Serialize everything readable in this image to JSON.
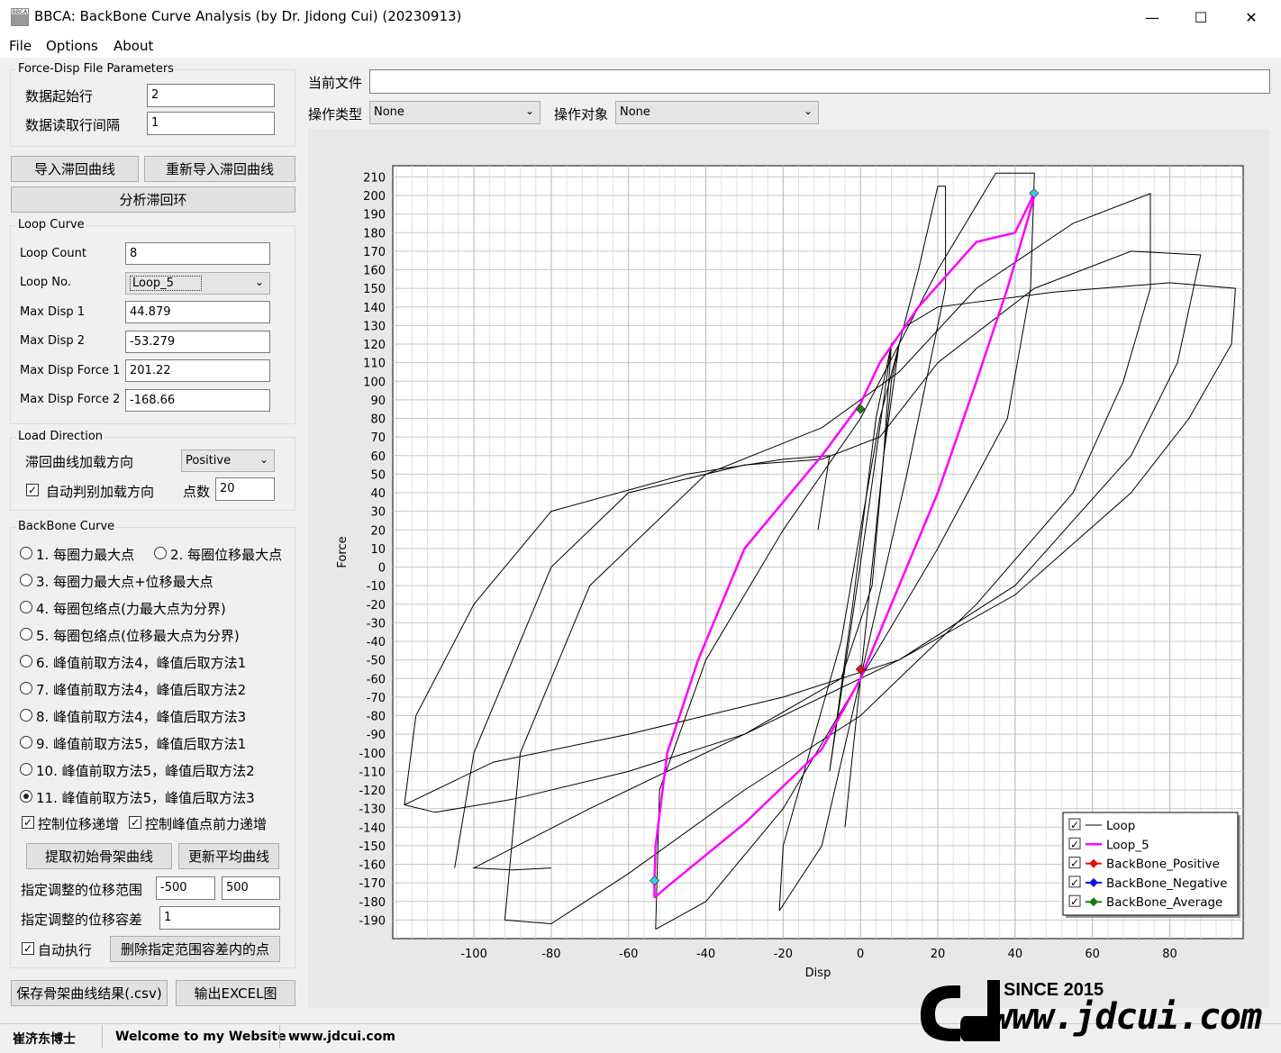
{
  "window": {
    "title": "BBCA: BackBone Curve Analysis (by Dr. Jidong Cui) (20230913)",
    "icon_text": "BBCA"
  },
  "menu": {
    "items": [
      "File",
      "Options",
      "About"
    ]
  },
  "params": {
    "group_title": "Force-Disp File Parameters",
    "start_row_label": "数据起始行",
    "start_row_value": "2",
    "interval_label": "数据读取行间隔",
    "interval_value": "1"
  },
  "buttons": {
    "import": "导入滞回曲线",
    "reimport": "重新导入滞回曲线",
    "analyze": "分析滞回环",
    "extract": "提取初始骨架曲线",
    "update_avg": "更新平均曲线",
    "delete_points": "删除指定范围容差内的点",
    "save_csv": "保存骨架曲线结果(.csv)",
    "export_excel": "输出EXCEL图"
  },
  "loop_curve": {
    "group_title": "Loop Curve",
    "loop_count_label": "Loop Count",
    "loop_count_value": "8",
    "loop_no_label": "Loop No.",
    "loop_no_value": "Loop_5",
    "max_disp1_label": "Max Disp 1",
    "max_disp1_value": "44.879",
    "max_disp2_label": "Max Disp 2",
    "max_disp2_value": "-53.279",
    "max_force1_label": "Max Disp Force 1",
    "max_force1_value": "201.22",
    "max_force2_label": "Max Disp Force 2",
    "max_force2_value": "-168.66"
  },
  "load_direction": {
    "group_title": "Load Direction",
    "dir_label": "滞回曲线加载方向",
    "dir_value": "Positive",
    "auto_label": "自动判别加载方向",
    "points_label": "点数",
    "points_value": "20"
  },
  "backbone": {
    "group_title": "BackBone Curve",
    "options": [
      "1. 每圈力最大点",
      "2. 每圈位移最大点",
      "3. 每圈力最大点+位移最大点",
      "4. 每圈包络点(力最大点为分界)",
      "5. 每圈包络点(位移最大点为分界)",
      "6. 峰值前取方法4，峰值后取方法1",
      "7. 峰值前取方法4，峰值后取方法2",
      "8. 峰值前取方法4，峰值后取方法3",
      "9. 峰值前取方法5，峰值后取方法1",
      "10. 峰值前取方法5，峰值后取方法2",
      "11. 峰值前取方法5，峰值后取方法3"
    ],
    "selected_index": 10,
    "ctrl_disp_label": "控制位移递增",
    "ctrl_force_label": "控制峰值点前力递增",
    "range_label": "指定调整的位移范围",
    "range_min": "-500",
    "range_max": "500",
    "tol_label": "指定调整的位移容差",
    "tol_value": "1",
    "auto_exec_label": "自动执行"
  },
  "top_controls": {
    "current_file_label": "当前文件",
    "current_file_value": "",
    "op_type_label": "操作类型",
    "op_type_value": "None",
    "op_target_label": "操作对象",
    "op_target_value": "None"
  },
  "status": {
    "author": "崔济东博士",
    "welcome": "Welcome to my Website",
    "site": "www.jdcui.com"
  },
  "logo": {
    "since": "SINCE 2015",
    "url": "www.jdcui.com"
  },
  "colors": {
    "loop": "#000000",
    "loop5": "#ff00ff",
    "positive": "#e01010",
    "negative": "#1010e0",
    "average": "#108010",
    "marker": "#3cc8f0"
  },
  "chart_data": {
    "type": "line",
    "xlabel": "Disp",
    "ylabel": "Force",
    "xlim": [
      -121,
      99
    ],
    "ylim": [
      -200,
      216
    ],
    "xticks": [
      -100,
      -80,
      -60,
      -40,
      -20,
      0,
      20,
      40,
      60,
      80
    ],
    "yticks": [
      210,
      200,
      190,
      180,
      170,
      160,
      150,
      140,
      130,
      120,
      110,
      100,
      90,
      80,
      70,
      60,
      50,
      40,
      30,
      20,
      10,
      0,
      -10,
      -20,
      -30,
      -40,
      -50,
      -60,
      -70,
      -80,
      -90,
      -100,
      -110,
      -120,
      -130,
      -140,
      -150,
      -160,
      -170,
      -180,
      -190
    ],
    "grid": true,
    "legend": [
      "Loop",
      "Loop_5",
      "BackBone_Positive",
      "BackBone_Negative",
      "BackBone_Average"
    ],
    "legend_position": "bottom-right",
    "series": [
      {
        "name": "Loop",
        "loops": [
          [
            [
              -11,
              20
            ],
            [
              -8,
              60
            ],
            [
              -20,
              58
            ],
            [
              -45,
              50
            ],
            [
              -80,
              30
            ],
            [
              -100,
              -20
            ],
            [
              -115,
              -80
            ],
            [
              -118,
              -128
            ],
            [
              -110,
              -132
            ],
            [
              -90,
              -125
            ],
            [
              -60,
              -110
            ],
            [
              -30,
              -90
            ],
            [
              -5,
              -60
            ],
            [
              3,
              -10
            ],
            [
              6,
              60
            ],
            [
              8,
              120
            ],
            [
              12,
              130
            ],
            [
              20,
              140
            ],
            [
              50,
              148
            ],
            [
              80,
              153
            ],
            [
              97,
              150
            ],
            [
              96,
              120
            ],
            [
              85,
              80
            ],
            [
              70,
              40
            ],
            [
              40,
              -15
            ],
            [
              10,
              -50
            ],
            [
              -20,
              -70
            ],
            [
              -60,
              -90
            ],
            [
              -95,
              -105
            ],
            [
              -118,
              -128
            ]
          ],
          [
            [
              -105,
              -162
            ],
            [
              -100,
              -100
            ],
            [
              -80,
              0
            ],
            [
              -60,
              40
            ],
            [
              -30,
              55
            ],
            [
              -10,
              58
            ],
            [
              5,
              70
            ],
            [
              20,
              110
            ],
            [
              45,
              150
            ],
            [
              70,
              170
            ],
            [
              88,
              168
            ],
            [
              82,
              110
            ],
            [
              70,
              60
            ],
            [
              40,
              -10
            ],
            [
              10,
              -50
            ],
            [
              -30,
              -90
            ],
            [
              -70,
              -130
            ],
            [
              -100,
              -162
            ],
            [
              -90,
              -163
            ],
            [
              -80,
              -162
            ]
          ],
          [
            [
              -92,
              -190
            ],
            [
              -88,
              -100
            ],
            [
              -70,
              -10
            ],
            [
              -40,
              50
            ],
            [
              -10,
              75
            ],
            [
              10,
              105
            ],
            [
              30,
              150
            ],
            [
              55,
              185
            ],
            [
              75,
              201
            ],
            [
              75,
              150
            ],
            [
              68,
              100
            ],
            [
              55,
              40
            ],
            [
              30,
              -20
            ],
            [
              0,
              -80
            ],
            [
              -30,
              -120
            ],
            [
              -60,
              -165
            ],
            [
              -80,
              -192
            ],
            [
              -92,
              -190
            ]
          ],
          [
            [
              -53,
              -195
            ],
            [
              -52,
              -120
            ],
            [
              -40,
              -50
            ],
            [
              -20,
              20
            ],
            [
              0,
              80
            ],
            [
              20,
              160
            ],
            [
              35,
              212
            ],
            [
              45,
              212
            ],
            [
              44,
              150
            ],
            [
              38,
              80
            ],
            [
              20,
              10
            ],
            [
              0,
              -60
            ],
            [
              -20,
              -130
            ],
            [
              -40,
              -180
            ],
            [
              -53,
              -195
            ]
          ],
          [
            [
              -21,
              -185
            ],
            [
              -20,
              -150
            ],
            [
              -5,
              -40
            ],
            [
              5,
              80
            ],
            [
              15,
              160
            ],
            [
              20,
              205
            ],
            [
              22,
              205
            ],
            [
              22,
              150
            ],
            [
              12,
              50
            ],
            [
              0,
              -60
            ],
            [
              -10,
              -150
            ],
            [
              -21,
              -185
            ]
          ],
          [
            [
              -4,
              -140
            ],
            [
              0,
              -60
            ],
            [
              6,
              60
            ],
            [
              10,
              120
            ],
            [
              8,
              100
            ],
            [
              2,
              -20
            ],
            [
              -4,
              -140
            ]
          ],
          [
            [
              -8,
              -110
            ],
            [
              -2,
              -20
            ],
            [
              4,
              80
            ],
            [
              8,
              120
            ],
            [
              2,
              30
            ],
            [
              -8,
              -110
            ]
          ]
        ]
      },
      {
        "name": "Loop_5",
        "points": [
          [
            -53.3,
            -178
          ],
          [
            -50,
            -172
          ],
          [
            -40,
            -155
          ],
          [
            -30,
            -138
          ],
          [
            -20,
            -118
          ],
          [
            -10,
            -98
          ],
          [
            0,
            -60
          ],
          [
            10,
            -10
          ],
          [
            20,
            40
          ],
          [
            30,
            100
          ],
          [
            38,
            150
          ],
          [
            43,
            185
          ],
          [
            45,
            200
          ],
          [
            44.9,
            201
          ],
          [
            40,
            180
          ],
          [
            30,
            175
          ],
          [
            15,
            140
          ],
          [
            5,
            110
          ],
          [
            0,
            88
          ],
          [
            -10,
            60
          ],
          [
            -20,
            35
          ],
          [
            -30,
            10
          ],
          [
            -42,
            -50
          ],
          [
            -50,
            -100
          ],
          [
            -53,
            -150
          ],
          [
            -53.3,
            -168
          ],
          [
            -53.3,
            -178
          ]
        ]
      },
      {
        "name": "BackBone_Positive",
        "points": [
          [
            0,
            -55
          ]
        ]
      },
      {
        "name": "BackBone_Average",
        "points": [
          [
            0,
            85
          ]
        ]
      },
      {
        "name": "Max markers",
        "points": [
          [
            44.9,
            201.2
          ],
          [
            -53.3,
            -168.7
          ]
        ]
      }
    ]
  }
}
